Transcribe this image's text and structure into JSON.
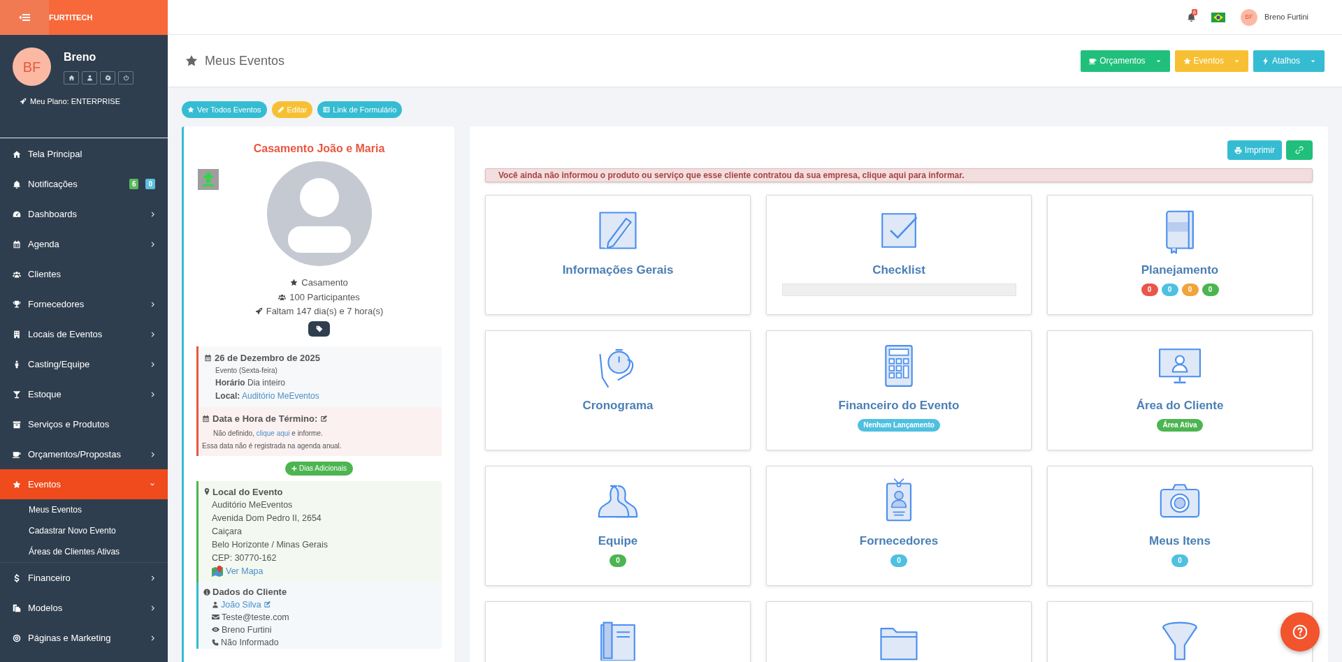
{
  "brand": "FURTITECH",
  "user": {
    "name": "Breno",
    "initials": "BF",
    "plan": "Meu Plano: ENTERPRISE"
  },
  "sidebar": {
    "items": [
      {
        "label": "Tela Principal",
        "chevron": false,
        "selected": false
      },
      {
        "label": "Notificações",
        "chevron": false,
        "selected": false,
        "badges": [
          {
            "text": "6",
            "color": "#5cb85c"
          },
          {
            "text": "0",
            "color": "#5bc0de"
          }
        ]
      },
      {
        "label": "Dashboards",
        "chevron": true,
        "selected": false,
        "expanded": false
      },
      {
        "label": "Agenda",
        "chevron": true,
        "selected": false,
        "expanded": false
      },
      {
        "label": "Clientes",
        "chevron": false,
        "selected": false
      },
      {
        "label": "Fornecedores",
        "chevron": true,
        "selected": false,
        "expanded": false
      },
      {
        "label": "Locais de Eventos",
        "chevron": true,
        "selected": false,
        "expanded": false
      },
      {
        "label": "Casting/Equipe",
        "chevron": true,
        "selected": false,
        "expanded": false
      },
      {
        "label": "Estoque",
        "chevron": true,
        "selected": false,
        "expanded": false
      },
      {
        "label": "Serviços e Produtos",
        "chevron": false,
        "selected": false
      },
      {
        "label": "Orçamentos/Propostas",
        "chevron": true,
        "selected": false,
        "expanded": false
      },
      {
        "label": "Eventos",
        "chevron": true,
        "selected": true,
        "expanded": true,
        "children": [
          {
            "label": "Meus Eventos"
          },
          {
            "label": "Cadastrar Novo Evento"
          },
          {
            "label": "Áreas de Clientes Ativas"
          }
        ]
      },
      {
        "label": "Financeiro",
        "chevron": true,
        "selected": false,
        "expanded": false
      },
      {
        "label": "Modelos",
        "chevron": true,
        "selected": false,
        "expanded": false
      },
      {
        "label": "Páginas e Marketing",
        "chevron": true,
        "selected": false,
        "expanded": false
      }
    ]
  },
  "topbar": {
    "notification_count": "6",
    "initials": "BF",
    "user_name": "Breno Furtini"
  },
  "header": {
    "title": "Meus Eventos",
    "buttons": [
      {
        "label": "Orçamentos",
        "color": "#20c07c"
      },
      {
        "label": "Eventos",
        "color": "#f7c034"
      },
      {
        "label": "Atalhos",
        "color": "#35bcd2"
      }
    ]
  },
  "actions": [
    {
      "label": "Ver Todos Eventos",
      "color": "#35bcd2"
    },
    {
      "label": "Editar",
      "color": "#f7c034"
    },
    {
      "label": "Link de Formulário",
      "color": "#35bcd2"
    }
  ],
  "event": {
    "title": "Casamento João e Maria",
    "type": "Casamento",
    "participants": "100 Participantes",
    "countdown": "Faltam 147 dia(s) e 7 hora(s)",
    "date": {
      "title": "26 de Dezembro de 2025",
      "weekday": "Evento (Sexta-feira)",
      "time_label": "Horário",
      "time": "Dia inteiro",
      "place_label": "Local:",
      "place": "Auditório MeEventos"
    },
    "end": {
      "title": "Data e Hora de Término:",
      "note_before": "Não definido,",
      "note_link": "clique aqui",
      "note_after": "e informe.",
      "footnote": "Essa data não é registrada na agenda anual."
    },
    "extra_days": "Dias Adicionais",
    "location": {
      "title": "Local do Evento",
      "lines": [
        "Auditório MeEventos",
        "Avenida Dom Pedro II, 2654",
        "Caiçara",
        "Belo Horizonte / Minas Gerais",
        "CEP: 30770-162"
      ],
      "map_link": "Ver Mapa"
    },
    "client": {
      "title": "Dados do Cliente",
      "name": "João Silva",
      "email": "Teste@teste.com",
      "owner": "Breno Furtini",
      "phone": "Não Informado"
    }
  },
  "main": {
    "print": "Imprimir",
    "alert": "Você ainda não informou o produto ou serviço que esse cliente contratou da sua empresa, clique aqui para informar.",
    "cards": [
      {
        "title": "Informações Gerais",
        "kind": "plain"
      },
      {
        "title": "Checklist",
        "kind": "progress",
        "level": 0
      },
      {
        "title": "Planejamento",
        "kind": "dots",
        "badges": [
          {
            "text": "0",
            "color": "#e8574a"
          },
          {
            "text": "0",
            "color": "#4fc0e0"
          },
          {
            "text": "0",
            "color": "#f0a43a"
          },
          {
            "text": "0",
            "color": "#4cb551"
          }
        ]
      },
      {
        "title": "Cronograma",
        "kind": "plain"
      },
      {
        "title": "Financeiro do Evento",
        "kind": "badge",
        "badge": {
          "text": "Nenhum Lançamento",
          "color": "#4fc0e0"
        }
      },
      {
        "title": "Área do Cliente",
        "kind": "badge",
        "badge": {
          "text": "Área Ativa",
          "color": "#4cb551"
        }
      },
      {
        "title": "Equipe",
        "kind": "badge",
        "badge": {
          "text": "0",
          "color": "#4cb551"
        }
      },
      {
        "title": "Fornecedores",
        "kind": "badge",
        "badge": {
          "text": "0",
          "color": "#4fc0e0"
        }
      },
      {
        "title": "Meus Itens",
        "kind": "badge",
        "badge": {
          "text": "0",
          "color": "#4fc0e0"
        }
      }
    ]
  }
}
